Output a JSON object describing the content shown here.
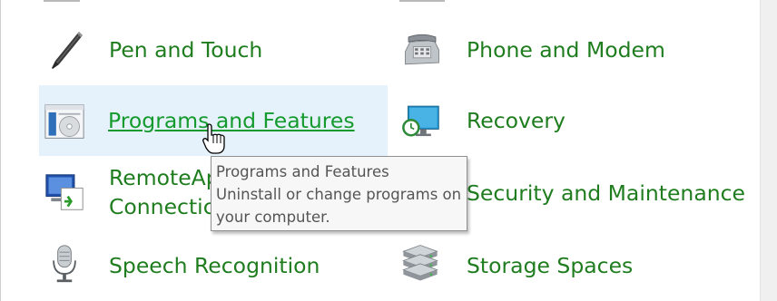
{
  "items": [
    {
      "label": "Pen and Touch",
      "icon": "pen-icon"
    },
    {
      "label": "Phone and Modem",
      "icon": "phone-icon"
    },
    {
      "label": "Programs and Features",
      "icon": "programs-icon",
      "hover": true
    },
    {
      "label": "Recovery",
      "icon": "recovery-icon"
    },
    {
      "label_line1": "RemoteAp",
      "label_line2": "Connectic",
      "icon": "remote-desktop-icon"
    },
    {
      "label": "Security and Maintenance",
      "icon": "security-flag-icon"
    },
    {
      "label": "Speech Recognition",
      "icon": "microphone-icon"
    },
    {
      "label": "Storage Spaces",
      "icon": "storage-spaces-icon"
    }
  ],
  "tooltip": {
    "title": "Programs and Features",
    "line1": "Uninstall or change programs on",
    "line2": "your computer."
  },
  "colors": {
    "link": "#1f7d1f",
    "hover_background": "#e5f2fc",
    "tooltip_background": "#f7f7f7"
  }
}
